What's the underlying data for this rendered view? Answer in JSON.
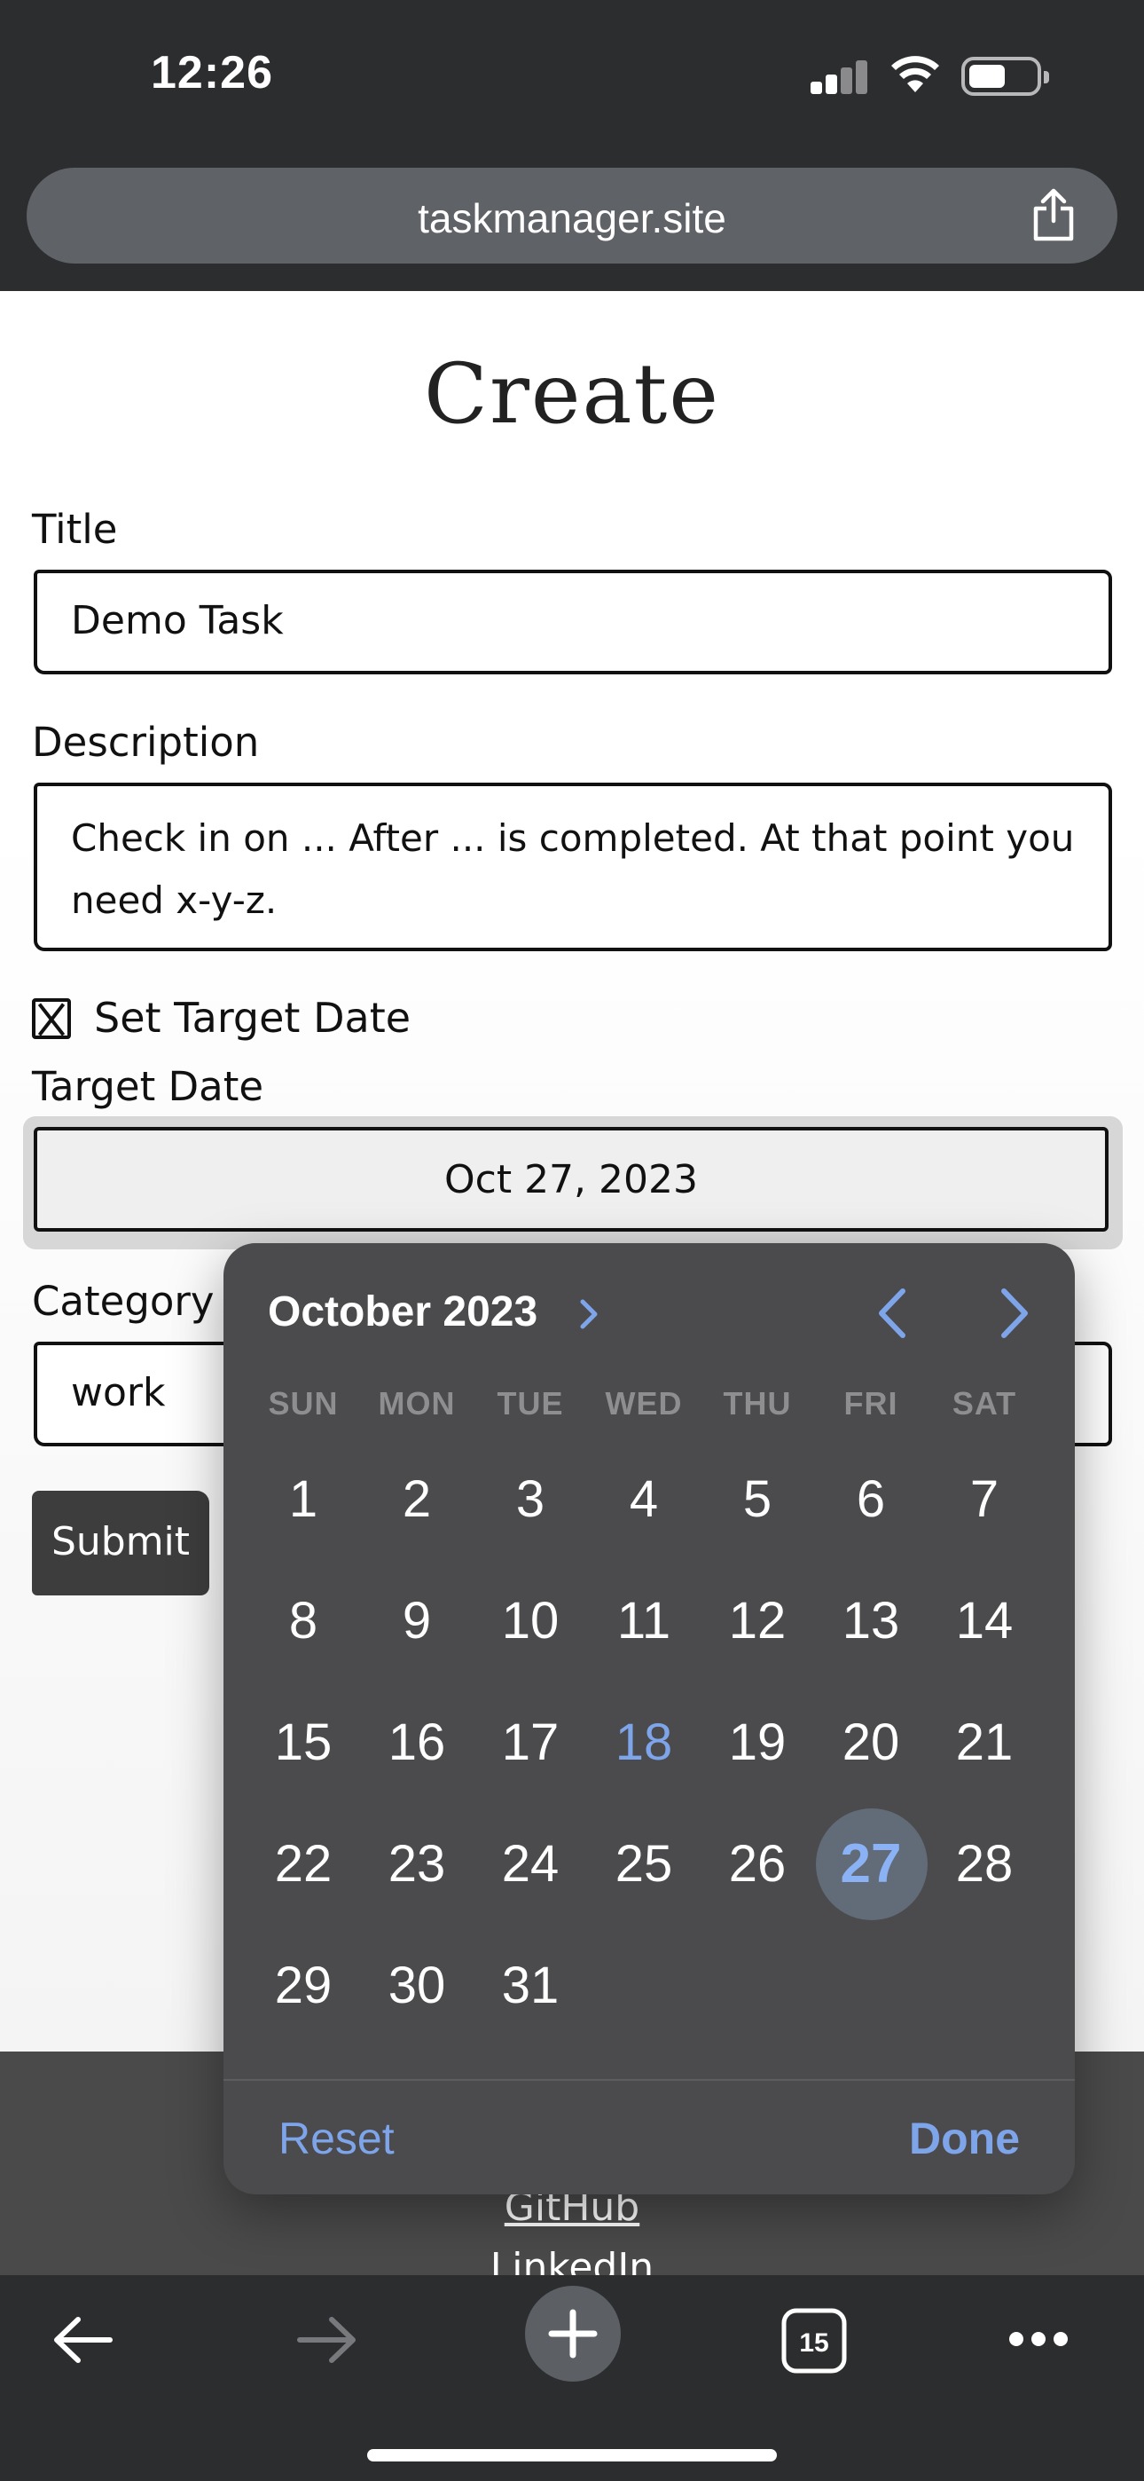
{
  "status_bar": {
    "time": "12:26"
  },
  "browser": {
    "url": "taskmanager.site",
    "tab_count": "15"
  },
  "page": {
    "title": "Create",
    "form": {
      "title_label": "Title",
      "title_value": "Demo Task",
      "description_label": "Description",
      "description_value": "Check in on ... After ... is completed.  At that point you need x-y-z.",
      "set_target_date_label": "Set Target Date",
      "set_target_date_checked": true,
      "target_date_label": "Target Date",
      "target_date_value": "Oct 27, 2023",
      "category_label": "Category",
      "category_value": "work",
      "submit_label": "Submit"
    },
    "footer": {
      "links": [
        "GitHub",
        "LinkedIn"
      ]
    }
  },
  "date_picker": {
    "month_label": "October 2023",
    "weekdays": [
      "SUN",
      "MON",
      "TUE",
      "WED",
      "THU",
      "FRI",
      "SAT"
    ],
    "days": [
      "1",
      "2",
      "3",
      "4",
      "5",
      "6",
      "7",
      "8",
      "9",
      "10",
      "11",
      "12",
      "13",
      "14",
      "15",
      "16",
      "17",
      "18",
      "19",
      "20",
      "21",
      "22",
      "23",
      "24",
      "25",
      "26",
      "27",
      "28",
      "29",
      "30",
      "31"
    ],
    "today": "18",
    "selected": "27",
    "reset_label": "Reset",
    "done_label": "Done",
    "accent_color": "#7ea4ea"
  },
  "icons": [
    "share-icon",
    "chevron-right-icon",
    "chevron-left-icon",
    "back-arrow-icon",
    "forward-arrow-icon",
    "plus-icon",
    "tabs-icon",
    "more-icon"
  ]
}
